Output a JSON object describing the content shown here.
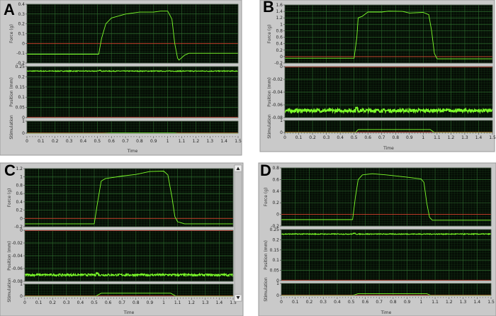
{
  "colors": {
    "trace": "#7dff2a",
    "zero_line": "#d23a2a",
    "plot_bg": "#050d05",
    "grid": "#2e6b2e",
    "panel_bg": "#c9c9c9"
  },
  "chart_data": [
    {
      "type": "line",
      "panel_label": "A",
      "xlabel": "Time",
      "xlim": [
        0,
        1.5
      ],
      "xticks": [
        "0",
        "0.1",
        "0.2",
        "0.3",
        "0.4",
        "0.5",
        "0.6",
        "0.7",
        "0.8",
        "0.9",
        "1",
        "1.1",
        "1.2",
        "1.3",
        "1.4",
        "1.5"
      ],
      "force": {
        "ylabel": "Force (g)",
        "ylim": [
          -0.2,
          0.4
        ],
        "yticks": [
          "-0.2",
          "-0.1",
          "0",
          "0.1",
          "0.2",
          "0.3",
          "0.4"
        ],
        "x": [
          0,
          0.51,
          0.53,
          0.56,
          0.6,
          0.7,
          0.8,
          0.9,
          0.95,
          1.0,
          1.03,
          1.05,
          1.07,
          1.08,
          1.12,
          1.15,
          1.5
        ],
        "y": [
          -0.11,
          -0.11,
          0.05,
          0.2,
          0.26,
          0.3,
          0.32,
          0.32,
          0.33,
          0.33,
          0.25,
          0.0,
          -0.15,
          -0.17,
          -0.12,
          -0.1,
          -0.1
        ]
      },
      "position": {
        "ylabel": "Position (mm)",
        "ylim": [
          0,
          0.25
        ],
        "yticks": [
          "0",
          "0.05",
          "0.1",
          "0.15",
          "0.2",
          "0.25"
        ],
        "level": 0.228,
        "noise": 0.002
      },
      "stimulation": {
        "ylabel": "Stimulation",
        "ylim": [
          0,
          1
        ],
        "yticks": [
          "0",
          "1"
        ],
        "x": [
          0,
          0.54,
          0.6,
          1.05,
          1.07,
          1.5
        ],
        "y": [
          0,
          0,
          0.03,
          0.03,
          0,
          0
        ]
      }
    },
    {
      "type": "line",
      "panel_label": "B",
      "xlabel": "Time",
      "xlim": [
        0,
        1.5
      ],
      "xticks": [
        "0",
        "0.1",
        "0.2",
        "0.3",
        "0.4",
        "0.5",
        "0.6",
        "0.7",
        "0.8",
        "0.9",
        "1",
        "1.1",
        "1.2",
        "1.3",
        "1.4",
        "1.5"
      ],
      "force": {
        "ylabel": "Force (g)",
        "ylim": [
          -0.2,
          1.6
        ],
        "yticks": [
          "-0.2",
          "0",
          "0.2",
          "0.4",
          "0.6",
          "0.8",
          "1",
          "1.2",
          "1.4",
          "1.6"
        ],
        "x": [
          0,
          0.5,
          0.52,
          0.53,
          0.56,
          0.6,
          0.7,
          0.75,
          0.85,
          0.9,
          1.0,
          1.04,
          1.06,
          1.08,
          1.1,
          1.5
        ],
        "y": [
          -0.05,
          -0.05,
          0.6,
          1.2,
          1.25,
          1.38,
          1.38,
          1.41,
          1.4,
          1.35,
          1.37,
          1.3,
          0.8,
          0.1,
          -0.07,
          -0.07
        ]
      },
      "position": {
        "ylabel": "Position (mm)",
        "ylim": [
          -0.08,
          0
        ],
        "yticks": [
          "-0.08",
          "-0.06",
          "-0.04",
          "-0.02",
          "0"
        ],
        "level": -0.069,
        "noise": 0.0025
      },
      "stimulation": {
        "ylabel": "Stimulation",
        "ylim": [
          0,
          1
        ],
        "yticks": [
          "0",
          "1"
        ],
        "x": [
          0,
          0.51,
          0.53,
          1.05,
          1.08,
          1.5
        ],
        "y": [
          0,
          0,
          0.25,
          0.25,
          0,
          0
        ]
      }
    },
    {
      "type": "line",
      "panel_label": "C",
      "xlabel": "Time",
      "xlim": [
        0,
        1.5
      ],
      "xticks": [
        "0",
        "0.1",
        "0.2",
        "0.3",
        "0.4",
        "0.5",
        "0.6",
        "0.7",
        "0.8",
        "0.9",
        "1",
        "1.1",
        "1.2",
        "1.3",
        "1.4",
        "1.5"
      ],
      "force": {
        "ylabel": "Force (g)",
        "ylim": [
          -0.2,
          1.2
        ],
        "yticks": [
          "-0.2",
          "0",
          "0.2",
          "0.4",
          "0.6",
          "0.8",
          "1",
          "1.2"
        ],
        "x": [
          0,
          0.5,
          0.52,
          0.55,
          0.58,
          0.7,
          0.8,
          0.9,
          1.0,
          1.03,
          1.06,
          1.08,
          1.1,
          1.15,
          1.5
        ],
        "y": [
          -0.13,
          -0.13,
          0.3,
          0.9,
          0.96,
          1.02,
          1.06,
          1.13,
          1.14,
          1.05,
          0.5,
          0.05,
          -0.08,
          -0.13,
          -0.13
        ]
      },
      "position": {
        "ylabel": "Position (mm)",
        "ylim": [
          -0.08,
          0
        ],
        "yticks": [
          "-0.08",
          "-0.06",
          "-0.04",
          "-0.02",
          "0"
        ],
        "level": -0.07,
        "noise": 0.0018
      },
      "stimulation": {
        "ylabel": "Stimulation",
        "ylim": [
          0,
          1
        ],
        "yticks": [
          "0",
          "1"
        ],
        "x": [
          0,
          0.51,
          0.55,
          1.05,
          1.09,
          1.5
        ],
        "y": [
          0,
          0,
          0.25,
          0.25,
          0,
          0
        ]
      }
    },
    {
      "type": "line",
      "panel_label": "D",
      "xlabel": "Time",
      "xlim": [
        0,
        1.5
      ],
      "xticks": [
        "0",
        "0.1",
        "0.2",
        "0.3",
        "0.4",
        "0.5",
        "0.6",
        "0.7",
        "0.8",
        "0.9",
        "1",
        "1.1",
        "1.2",
        "1.3",
        "1.4",
        "1.5"
      ],
      "force": {
        "ylabel": "Force (g)",
        "ylim": [
          -0.2,
          0.8
        ],
        "yticks": [
          "-0.2",
          "0",
          "0.2",
          "0.4",
          "0.6",
          "0.8"
        ],
        "x": [
          0,
          0.51,
          0.53,
          0.55,
          0.58,
          0.65,
          0.75,
          0.9,
          1.0,
          1.02,
          1.04,
          1.06,
          1.08,
          1.5
        ],
        "y": [
          -0.09,
          -0.09,
          0.3,
          0.6,
          0.68,
          0.7,
          0.68,
          0.64,
          0.61,
          0.55,
          0.2,
          -0.05,
          -0.1,
          -0.1
        ]
      },
      "position": {
        "ylabel": "Position (mm)",
        "ylim": [
          0,
          0.25
        ],
        "yticks": [
          "0",
          "0.05",
          "0.1",
          "0.15",
          "0.2",
          "0.25"
        ],
        "level": 0.228,
        "noise": 0.002
      },
      "stimulation": {
        "ylabel": "Stimulation",
        "ylim": [
          0,
          1
        ],
        "yticks": [
          "0",
          "1"
        ],
        "x": [
          0,
          0.51,
          0.55,
          1.04,
          1.07,
          1.5
        ],
        "y": [
          0,
          0,
          0.15,
          0.15,
          0,
          0
        ]
      }
    }
  ]
}
